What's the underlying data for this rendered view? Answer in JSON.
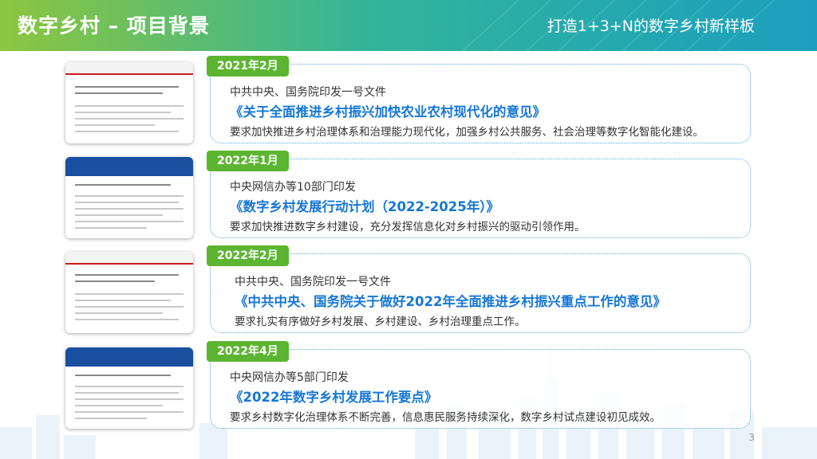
{
  "header": {
    "title": "数字乡村 – 项目背景",
    "slogan": "打造1+3+N的数字乡村新样板"
  },
  "colors": {
    "header_gradient": [
      "#8cc63f",
      "#33b49a",
      "#1a9fbf"
    ],
    "date_badge": "#5cb531",
    "doc_title": "#1677d6",
    "card_border": "#4fa8d8"
  },
  "items": [
    {
      "date": "2021年2月",
      "issuer": "中共中央、国务院印发一号文件",
      "doc_title": "《关于全面推进乡村振兴加快农业农村现代化的意见》",
      "requirement": "要求加快推进乡村治理体系和治理能力现代化，加强乡村公共服务、社会治理等数字化智能化建设。",
      "thumbnail": "document-screenshot-red-header"
    },
    {
      "date": "2022年1月",
      "issuer": "中央网信办等10部门印发",
      "doc_title": "《数字乡村发展行动计划（2022-2025年）》",
      "requirement": "要求加快推进数字乡村建设，充分发挥信息化对乡村振兴的驱动引领作用。",
      "thumbnail": "document-screenshot-blue-header"
    },
    {
      "date": "2022年2月",
      "issuer": "中共中央、国务院印发一号文件",
      "doc_title": "《中共中央、国务院关于做好2022年全面推进乡村振兴重点工作的意见》",
      "requirement": "要求扎实有序做好乡村发展、乡村建设、乡村治理重点工作。",
      "thumbnail": "document-screenshot-red-header"
    },
    {
      "date": "2022年4月",
      "issuer": "中央网信办等5部门印发",
      "doc_title": "《2022年数字乡村发展工作要点》",
      "requirement": "要求乡村数字化治理体系不断完善，信息惠民服务持续深化，数字乡村试点建设初见成效。",
      "thumbnail": "document-screenshot-blue-header"
    }
  ],
  "page_number": "3"
}
